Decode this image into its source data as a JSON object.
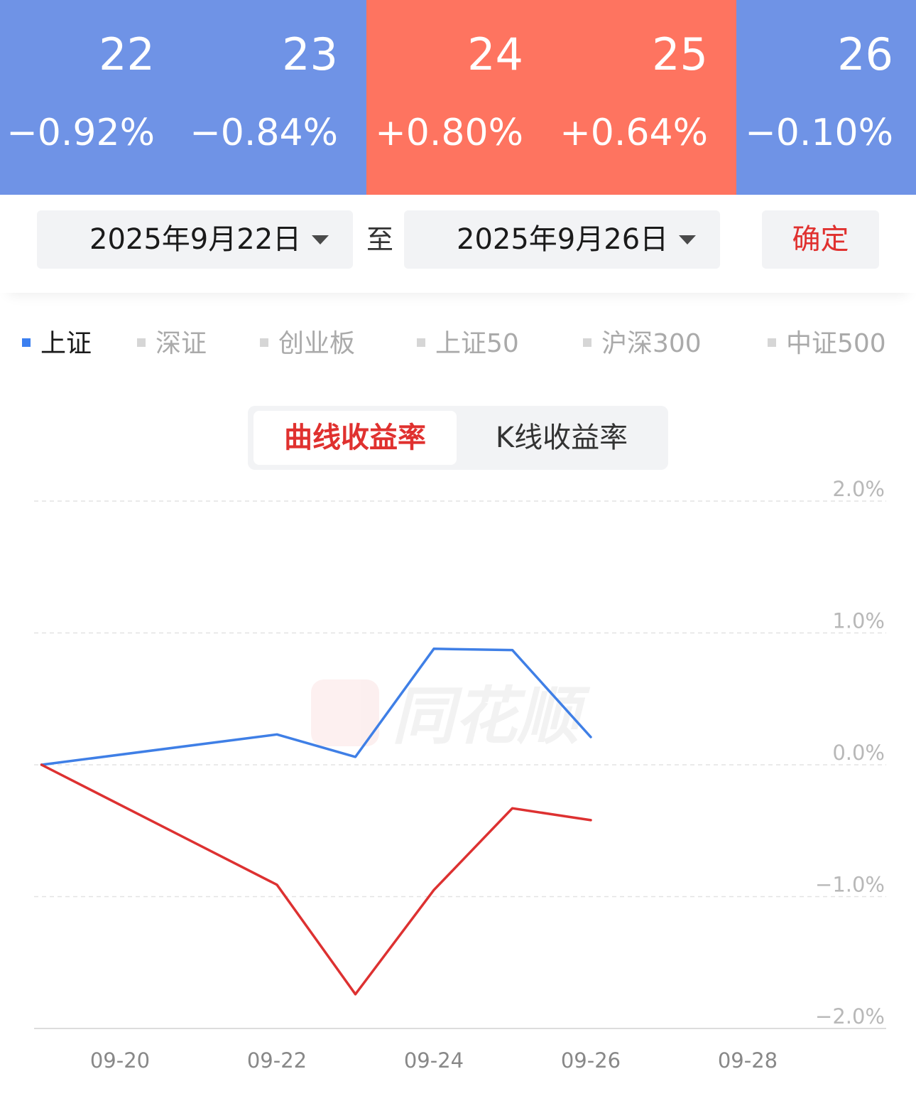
{
  "day_strip": [
    {
      "day": "22",
      "change": "−0.92%",
      "direction": "down"
    },
    {
      "day": "23",
      "change": "−0.84%",
      "direction": "down"
    },
    {
      "day": "24",
      "change": "+0.80%",
      "direction": "up"
    },
    {
      "day": "25",
      "change": "+0.64%",
      "direction": "up"
    },
    {
      "day": "26",
      "change": "−0.10%",
      "direction": "down"
    }
  ],
  "colors": {
    "down": "#6f93e6",
    "up": "#fe7460",
    "series_blue": "#3f7fe6",
    "series_red": "#dd3131",
    "accent_red": "#e0312f"
  },
  "date_range": {
    "start": "2025年9月22日",
    "to_label": "至",
    "end": "2025年9月26日",
    "confirm_label": "确定"
  },
  "index_tabs": [
    {
      "label": "上证",
      "active": true
    },
    {
      "label": "深证",
      "active": false
    },
    {
      "label": "创业板",
      "active": false
    },
    {
      "label": "上证50",
      "active": false
    },
    {
      "label": "沪深300",
      "active": false
    },
    {
      "label": "中证500",
      "active": false
    }
  ],
  "mode_toggle": {
    "active": "曲线收益率",
    "inactive": "K线收益率"
  },
  "watermark": "同花顺",
  "chart_data": {
    "type": "line",
    "x_tick_labels": [
      "09-20",
      "09-22",
      "09-24",
      "09-26",
      "09-28"
    ],
    "y_tick_labels": [
      "2.0%",
      "1.0%",
      "0.0%",
      "−1.0%",
      "−2.0%"
    ],
    "ylim": [
      -2.0,
      2.0
    ],
    "grid": true,
    "series": [
      {
        "color": "blue",
        "x": [
          "09-19",
          "09-22",
          "09-23",
          "09-24",
          "09-25",
          "09-26"
        ],
        "values": [
          0.0,
          0.23,
          0.06,
          0.88,
          0.87,
          0.21
        ]
      },
      {
        "color": "red",
        "x": [
          "09-19",
          "09-22",
          "09-23",
          "09-24",
          "09-25",
          "09-26"
        ],
        "values": [
          0.0,
          -0.91,
          -1.74,
          -0.95,
          -0.33,
          -0.42
        ]
      }
    ]
  }
}
